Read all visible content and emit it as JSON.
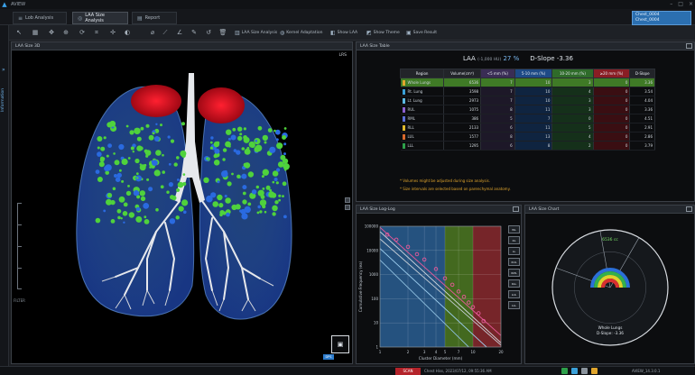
{
  "app": {
    "title": "AVIEW"
  },
  "tabs": [
    {
      "label": "Lob Analysis",
      "icon": "list-icon"
    },
    {
      "label": "LAA Size Analysis",
      "icon": "circle-icon"
    },
    {
      "label": "Report",
      "icon": "report-icon"
    }
  ],
  "patient": {
    "line1": "Chest_0004",
    "line2": "Chest_0004"
  },
  "toolbar": {
    "buttons": [
      {
        "label": "LAA Size Analysis",
        "icon": "chart-icon"
      },
      {
        "label": "Kernel Adaptation",
        "icon": "kernel-icon"
      },
      {
        "label": "Show LAA",
        "icon": "show-icon"
      },
      {
        "label": "Show Theme",
        "icon": "theme-icon"
      },
      {
        "label": "Save Result",
        "icon": "save-icon"
      }
    ]
  },
  "rail": {
    "label": "Information"
  },
  "viewer": {
    "title": "LAA Size 3D",
    "corner": "LRS",
    "slider_label": "FILTER",
    "badge": "DPS",
    "cube_glyph": "▣"
  },
  "table_panel": {
    "title": "LAA Size Table",
    "laa_label": "LAA",
    "laa_small": "(-1,000 HU)",
    "laa_value": "27 %",
    "dslope_label": "D-Slope",
    "dslope_value": "-3.36",
    "headers": [
      "Region",
      "Volume(cm³)",
      "<5 mm (%)",
      "5-10 mm (%)",
      "10-20 mm (%)",
      "≥20 mm (%)",
      "D-Slope"
    ],
    "header_colors": [
      "#222429",
      "#222429",
      "#3a2d55",
      "#1e4a86",
      "#2f6b2a",
      "#8a1d24",
      "#222429"
    ],
    "rows": [
      {
        "region": "Whole Lungs",
        "color": "#e0a52d",
        "values": [
          "6536",
          "7",
          "10",
          "3",
          "0",
          "3.36"
        ],
        "highlight": true
      },
      {
        "region": "Rt. Lung",
        "color": "#3aa0d8",
        "values": [
          "3598",
          "7",
          "10",
          "4",
          "0",
          "3.54"
        ]
      },
      {
        "region": "Lt. Lung",
        "color": "#5cb8e0",
        "values": [
          "2973",
          "7",
          "10",
          "3",
          "0",
          "4.04"
        ]
      },
      {
        "region": "RUL",
        "color": "#8c5fcf",
        "values": [
          "1075",
          "8",
          "11",
          "3",
          "0",
          "3.36"
        ]
      },
      {
        "region": "RML",
        "color": "#5c6fd8",
        "values": [
          "386",
          "5",
          "7",
          "0",
          "0",
          "4.51"
        ]
      },
      {
        "region": "RLL",
        "color": "#e0b92d",
        "values": [
          "2133",
          "6",
          "11",
          "5",
          "0",
          "2.91"
        ]
      },
      {
        "region": "LUL",
        "color": "#d8692d",
        "values": [
          "1577",
          "8",
          "13",
          "4",
          "0",
          "2.86"
        ]
      },
      {
        "region": "LLL",
        "color": "#2da04a",
        "values": [
          "1295",
          "6",
          "8",
          "2",
          "0",
          "3.79"
        ]
      }
    ],
    "notes": [
      "* Volumes might be adjusted during size analysis.",
      "* Size intervals are selected based on parenchymal anatomy."
    ]
  },
  "loglog_panel": {
    "title": "LAA Size Log-Log"
  },
  "size_panel": {
    "title": "LAA Size Chart"
  },
  "chart_data": [
    {
      "type": "scatter",
      "title": "LAA Size Log-Log",
      "xlabel": "Cluster Diameter (mm)",
      "ylabel": "Cumulative Frequency (ea)",
      "xscale": "log",
      "yscale": "log",
      "xlim": [
        1,
        20
      ],
      "ylim": [
        1,
        100000
      ],
      "xticks": [
        "1",
        "2",
        "3",
        "4",
        "5",
        "7",
        "10",
        "20"
      ],
      "yticks": [
        "1",
        "10",
        "100",
        "1000",
        "10000",
        "100000"
      ],
      "bands": [
        {
          "from": 1,
          "to": 5,
          "color": "#2a5f93"
        },
        {
          "from": 5,
          "to": 10,
          "color": "#4e7a22"
        },
        {
          "from": 10,
          "to": 20,
          "color": "#8a2a2e"
        }
      ],
      "series": [
        {
          "points": [
            [
              1.2,
              45000
            ],
            [
              1.5,
              28000
            ],
            [
              2,
              14000
            ],
            [
              2.5,
              7000
            ],
            [
              3,
              4200
            ],
            [
              4,
              1700
            ],
            [
              5,
              700
            ],
            [
              6,
              380
            ],
            [
              7,
              200
            ],
            [
              8,
              120
            ],
            [
              9,
              70
            ],
            [
              10,
              45
            ],
            [
              11.5,
              25
            ],
            [
              13,
              12
            ]
          ],
          "color": "#e8599a"
        }
      ],
      "fit_lines": [
        {
          "from": [
            1,
            90000
          ],
          "to": [
            20,
            3
          ],
          "color": "#e8599a"
        },
        {
          "from": [
            1,
            60000
          ],
          "to": [
            20,
            1.5
          ],
          "color": "#d7dde3"
        },
        {
          "from": [
            1,
            30000
          ],
          "to": [
            20,
            1.2
          ],
          "color": "#c8d0d8"
        },
        {
          "from": [
            1,
            12000
          ],
          "to": [
            14,
            1
          ],
          "color": "#9fd0f0"
        },
        {
          "from": [
            1,
            4000
          ],
          "to": [
            9,
            1
          ],
          "color": "#8fc0e0"
        }
      ],
      "legend": [
        "WL",
        "RL",
        "LL",
        "RUL",
        "RML",
        "RLL",
        "LUL",
        "LLL"
      ],
      "legend_placement": "right"
    },
    {
      "type": "pie",
      "title": "LAA Size Chart",
      "center_text_top": "6536 cc",
      "center_text_bottom": [
        "Whole Lungs",
        "D-Slope: -3.36"
      ],
      "arcs": [
        {
          "name": "<5 mm",
          "color": "#2b6fd8"
        },
        {
          "name": "5-10 mm",
          "color": "#35b04a"
        },
        {
          "name": "10-20 mm",
          "color": "#e0d22d"
        },
        {
          "name": "≥20 mm",
          "color": "#d83030"
        }
      ]
    }
  ],
  "status": {
    "alert": "SCAN",
    "text": "Chest Hiss, 2023/07/12, 09:55:36 AM",
    "version": "AVIEW_14.3.0.1"
  }
}
